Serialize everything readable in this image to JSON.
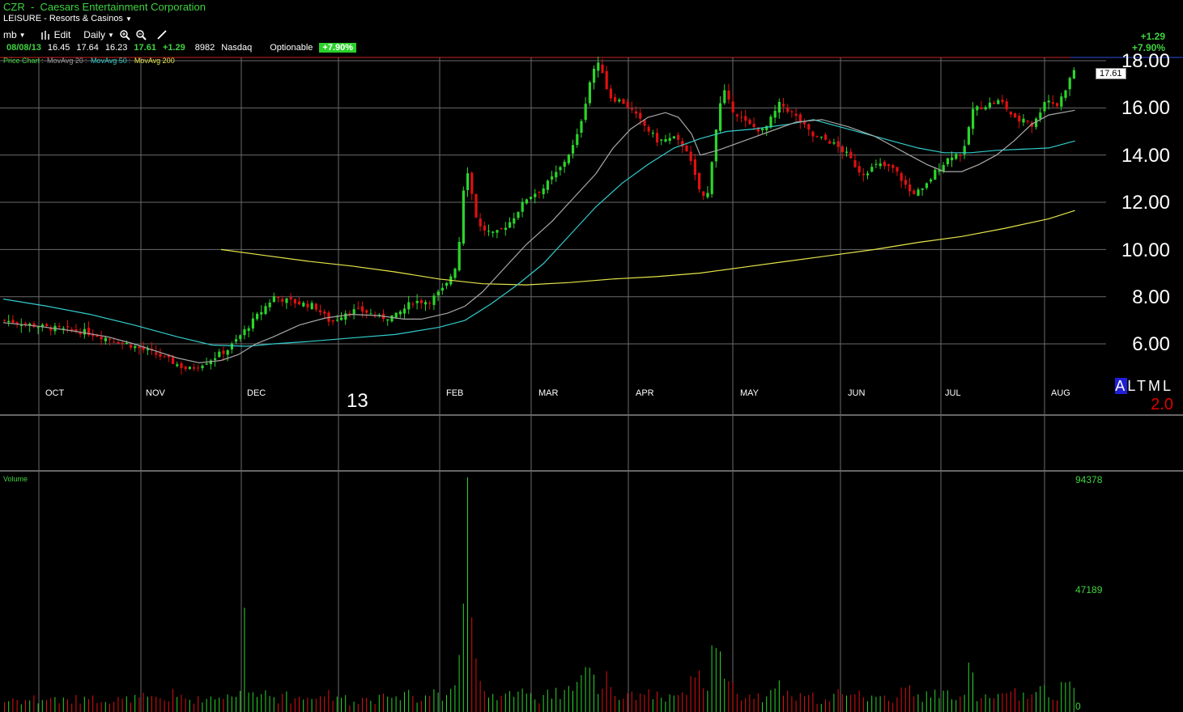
{
  "header": {
    "symbol": "CZR",
    "company": "Caesars Entertainment Corporation",
    "industry": "LEISURE - Resorts & Casinos"
  },
  "toolbar": {
    "user": "mb",
    "edit_label": "Edit",
    "period": "Daily"
  },
  "quote": {
    "date": "08/08/13",
    "open": "16.45",
    "high": "17.64",
    "low": "16.23",
    "close": "17.61",
    "change": "+1.29",
    "volume": "8982",
    "exchange": "Nasdaq",
    "optionable": "Optionable",
    "pct_change": "+7.90%"
  },
  "change_box": {
    "change": "+1.29",
    "pct": "+7.90%"
  },
  "legend": {
    "price_chart": "Price Chart",
    "ma20": "MovAvg 20",
    "ma50": "MovAvg 50",
    "ma200": "MovAvg 200"
  },
  "last_price_tag": "17.61",
  "price_axis": [
    "18.00",
    "16.00",
    "14.00",
    "12.00",
    "10.00",
    "8.00",
    "6.00"
  ],
  "months": [
    "OCT",
    "NOV",
    "DEC",
    "FEB",
    "MAR",
    "APR",
    "MAY",
    "JUN",
    "JUL",
    "AUG"
  ],
  "year_label": "13",
  "altml": {
    "a": "A",
    "rest": "LTML"
  },
  "rating": "2.0",
  "volume_panel": {
    "title": "Volume",
    "axis": [
      "94378",
      "47189",
      "0"
    ]
  },
  "colors": {
    "up": "#2bd52b",
    "down": "#e01010",
    "ma20": "#a8a8a8",
    "ma50": "#33cccc",
    "ma200": "#e6e64a",
    "grid": "#6a6a6a",
    "red_line": "#cc2222"
  },
  "chart_data": {
    "type": "candlestick",
    "ylim": [
      4.5,
      18.5
    ],
    "ma20": [
      [
        0,
        6.9
      ],
      [
        8,
        6.75
      ],
      [
        16,
        6.55
      ],
      [
        24,
        6.3
      ],
      [
        30,
        6.0
      ],
      [
        35,
        5.7
      ],
      [
        40,
        5.4
      ],
      [
        45,
        5.2
      ],
      [
        50,
        5.3
      ],
      [
        54,
        5.55
      ],
      [
        58,
        6.0
      ],
      [
        62,
        6.3
      ],
      [
        68,
        6.8
      ],
      [
        74,
        7.1
      ],
      [
        80,
        7.25
      ],
      [
        86,
        7.2
      ],
      [
        92,
        7.05
      ],
      [
        96,
        7.05
      ],
      [
        102,
        7.3
      ],
      [
        106,
        7.6
      ],
      [
        110,
        8.2
      ],
      [
        114,
        9.0
      ],
      [
        120,
        10.2
      ],
      [
        126,
        11.2
      ],
      [
        130,
        12.0
      ],
      [
        136,
        13.2
      ],
      [
        140,
        14.3
      ],
      [
        144,
        15.1
      ],
      [
        148,
        15.6
      ],
      [
        152,
        15.8
      ],
      [
        155,
        15.6
      ],
      [
        158,
        14.9
      ],
      [
        160,
        14.0
      ],
      [
        164,
        14.2
      ],
      [
        170,
        14.6
      ],
      [
        176,
        15.0
      ],
      [
        182,
        15.4
      ],
      [
        188,
        15.5
      ],
      [
        194,
        15.2
      ],
      [
        200,
        14.8
      ],
      [
        204,
        14.4
      ],
      [
        208,
        14.0
      ],
      [
        212,
        13.6
      ],
      [
        216,
        13.3
      ],
      [
        220,
        13.3
      ],
      [
        224,
        13.6
      ],
      [
        228,
        14.0
      ],
      [
        232,
        14.6
      ],
      [
        236,
        15.3
      ],
      [
        240,
        15.7
      ],
      [
        246,
        15.9
      ]
    ],
    "ma50": [
      [
        0,
        7.9
      ],
      [
        10,
        7.6
      ],
      [
        20,
        7.25
      ],
      [
        30,
        6.8
      ],
      [
        40,
        6.3
      ],
      [
        48,
        5.95
      ],
      [
        56,
        5.9
      ],
      [
        62,
        6.0
      ],
      [
        70,
        6.1
      ],
      [
        80,
        6.25
      ],
      [
        90,
        6.4
      ],
      [
        100,
        6.7
      ],
      [
        106,
        7.0
      ],
      [
        112,
        7.7
      ],
      [
        118,
        8.5
      ],
      [
        124,
        9.4
      ],
      [
        130,
        10.6
      ],
      [
        136,
        11.8
      ],
      [
        142,
        12.8
      ],
      [
        148,
        13.6
      ],
      [
        154,
        14.3
      ],
      [
        160,
        14.7
      ],
      [
        166,
        15.0
      ],
      [
        172,
        15.1
      ],
      [
        180,
        15.3
      ],
      [
        186,
        15.5
      ],
      [
        192,
        15.2
      ],
      [
        198,
        14.9
      ],
      [
        204,
        14.6
      ],
      [
        210,
        14.3
      ],
      [
        216,
        14.1
      ],
      [
        222,
        14.1
      ],
      [
        228,
        14.2
      ],
      [
        234,
        14.25
      ],
      [
        240,
        14.3
      ],
      [
        246,
        14.6
      ]
    ],
    "ma200": [
      [
        50,
        10.0
      ],
      [
        60,
        9.75
      ],
      [
        70,
        9.5
      ],
      [
        80,
        9.3
      ],
      [
        90,
        9.05
      ],
      [
        100,
        8.75
      ],
      [
        110,
        8.55
      ],
      [
        120,
        8.5
      ],
      [
        130,
        8.6
      ],
      [
        140,
        8.75
      ],
      [
        150,
        8.85
      ],
      [
        160,
        9.0
      ],
      [
        170,
        9.25
      ],
      [
        180,
        9.5
      ],
      [
        190,
        9.75
      ],
      [
        200,
        10.0
      ],
      [
        210,
        10.3
      ],
      [
        220,
        10.55
      ],
      [
        230,
        10.9
      ],
      [
        240,
        11.3
      ],
      [
        246,
        11.65
      ]
    ]
  }
}
